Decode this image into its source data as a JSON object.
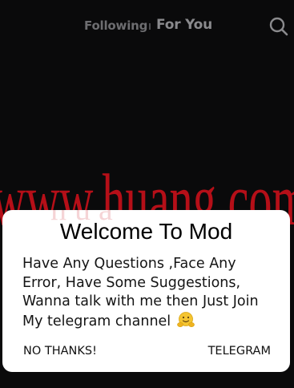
{
  "header": {
    "tab_following": "Following",
    "tab_for_you": "For You",
    "search_icon": "search-icon"
  },
  "watermark": {
    "text": "www.huang.com",
    "color": "#c8101a"
  },
  "dialog": {
    "title": "Welcome To Mod",
    "message_lines": [
      "Have Any Questions ,Face Any",
      "Error, Have Some Suggestions,",
      "Wanna talk with me then Just Join",
      "My telegram channel"
    ],
    "emoji_icon": "hugging-face-emoji",
    "negative_label": "NO THANKS!",
    "positive_label": "TELEGRAM"
  },
  "colors": {
    "background": "#0a0a0b",
    "dialog_bg": "#ffffff",
    "tab_inactive": "#6d6d70",
    "tab_active": "#8a8a8d"
  }
}
